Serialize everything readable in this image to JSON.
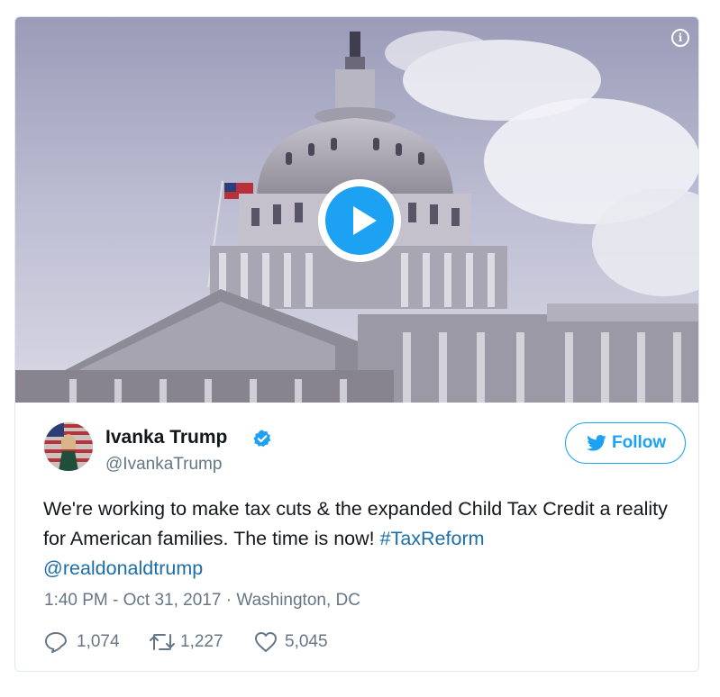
{
  "media": {
    "info_icon_glyph": "i",
    "play_icon": "play-icon",
    "accent": "#1da1f2"
  },
  "author": {
    "name": "Ivanka Trump",
    "handle": "@IvankaTrump",
    "verified": true
  },
  "follow_button": {
    "label": "Follow"
  },
  "tweet": {
    "text_plain": "We're working to make tax cuts & the expanded Child Tax Credit a reality for American families. The time is now! ",
    "hashtag": "#TaxReform",
    "mention": "@realdonaldtrump"
  },
  "meta": {
    "time": "1:40 PM - Oct 31, 2017",
    "separator": " · ",
    "location": "Washington, DC"
  },
  "actions": {
    "replies": "1,074",
    "retweets": "1,227",
    "likes": "5,045"
  },
  "colors": {
    "text": "#14171a",
    "secondary": "#657786",
    "link": "#1b6ea8",
    "brand": "#1da1f2"
  }
}
